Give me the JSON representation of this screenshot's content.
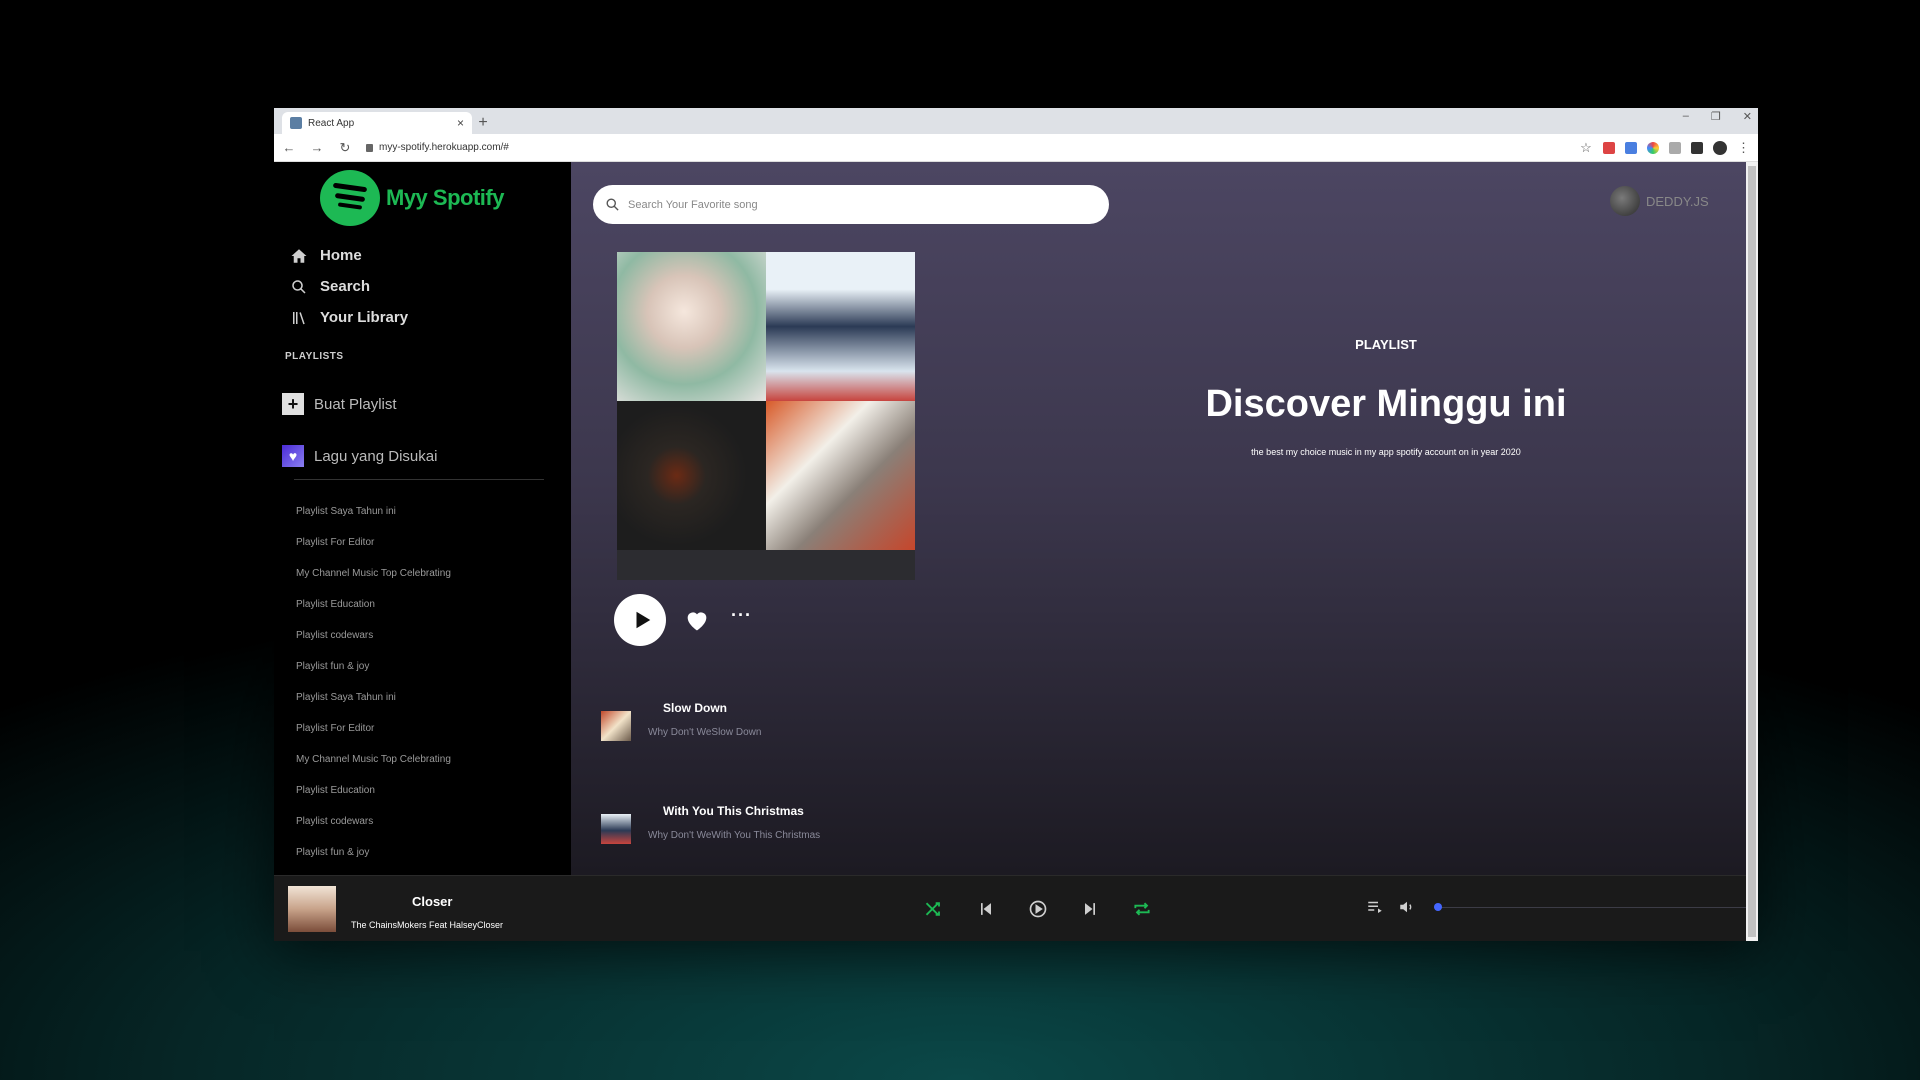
{
  "browser": {
    "tab_title": "React App",
    "tab_close": "×",
    "new_tab": "+",
    "url": "myy-spotify.herokuapp.com/#",
    "win_min": "–",
    "win_max": "❐",
    "win_close": "✕",
    "back": "←",
    "forward": "→",
    "reload": "↻",
    "star": "☆",
    "menu": "⋮"
  },
  "sidebar": {
    "logo_text": "Myy Spotify",
    "menu": [
      {
        "label": "Home",
        "icon": "home-icon"
      },
      {
        "label": "Search",
        "icon": "search-icon"
      },
      {
        "label": "Your Library",
        "icon": "library-icon"
      }
    ],
    "section_title": "PLAYLISTS",
    "create_playlist": "Buat Playlist",
    "create_icon": "+",
    "liked_songs": "Lagu yang Disukai",
    "liked_icon": "♥",
    "playlists": [
      "Playlist Saya Tahun ini",
      "Playlist For Editor",
      "My Channel Music Top Celebrating",
      "Playlist Education",
      "Playlist codewars",
      "Playlist fun & joy",
      "Playlist Saya Tahun ini",
      "Playlist For Editor",
      "My Channel Music Top Celebrating",
      "Playlist Education",
      "Playlist codewars",
      "Playlist fun & joy"
    ]
  },
  "main": {
    "search_placeholder": "Search Your Favorite song",
    "user_name": "DEDDY.JS",
    "playlist_type": "PLAYLIST",
    "playlist_title": "Discover Minggu ini",
    "playlist_desc": "the best my choice music in my app spotify account on in year 2020",
    "more_label": "···",
    "tracks": [
      {
        "name": "Slow Down",
        "artist": "Why Don't WeSlow Down"
      },
      {
        "name": "With You This Christmas",
        "artist": "Why Don't WeWith You This Christmas"
      }
    ]
  },
  "player": {
    "title": "Closer",
    "artist": "The ChainsMokers Feat HalseyCloser",
    "volume": 0,
    "accent_color": "#1db954",
    "volume_color": "#4466ff"
  }
}
